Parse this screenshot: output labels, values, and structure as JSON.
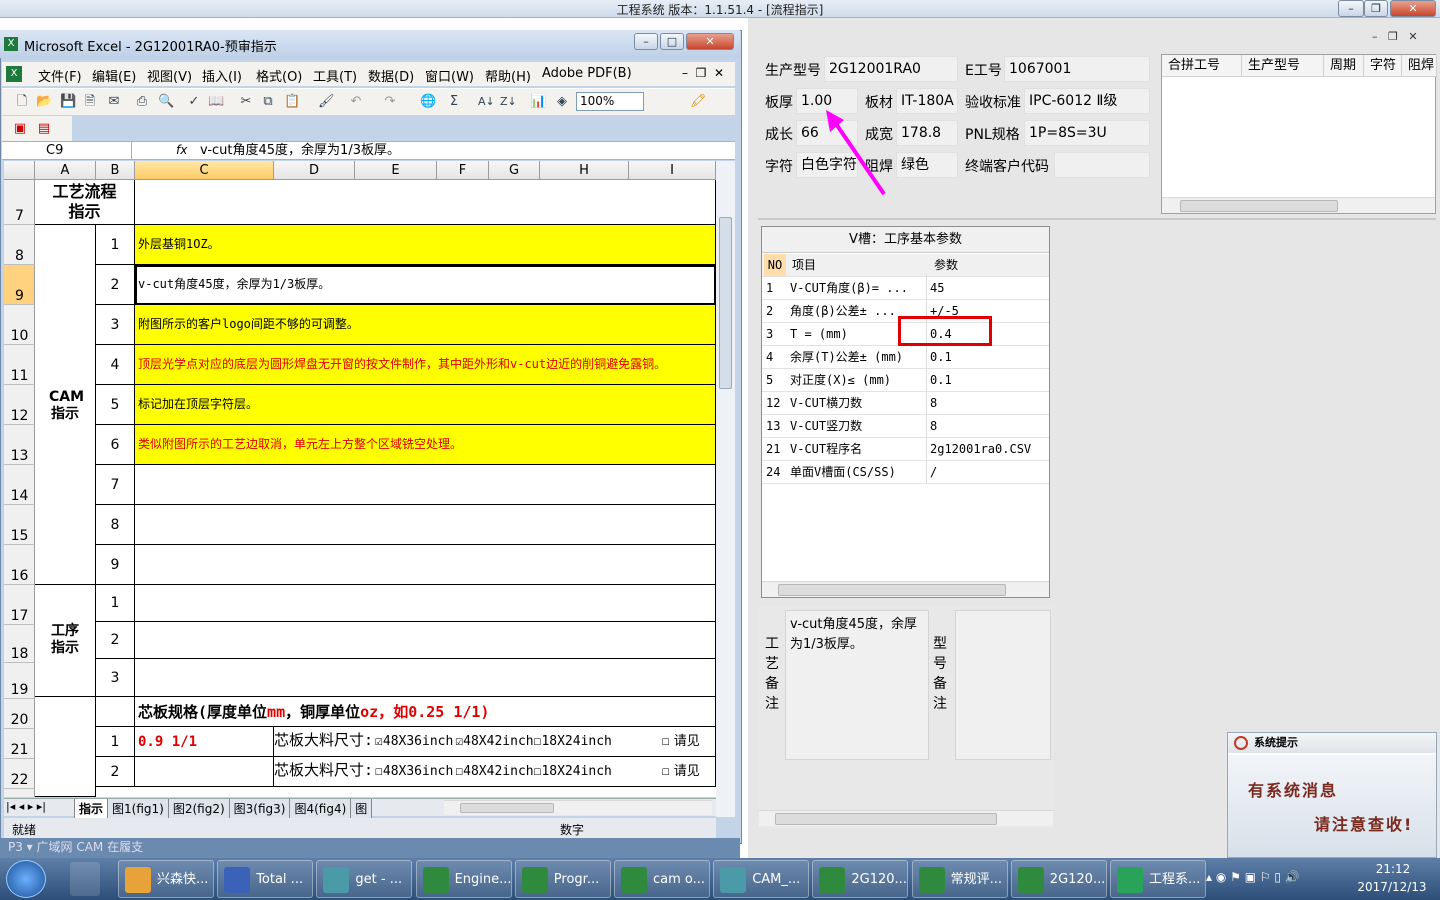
{
  "app_title": "工程系统  版本：1.1.51.4 - [流程指示]",
  "right": {
    "fields": {
      "model_label": "生产型号",
      "model_value": "2G12001RA0",
      "eno_label": "E工号",
      "eno_value": "1067001",
      "thick_label": "板厚",
      "thick_value": "1.00",
      "material_label": "板材",
      "material_value": "IT-180A",
      "std_label": "验收标准",
      "std_value": "IPC-6012 Ⅱ级",
      "len_label": "成长",
      "len_value": "66",
      "wid_label": "成宽",
      "wid_value": "178.8",
      "pnl_label": "PNL规格",
      "pnl_value": "1P=8S=3U",
      "char_label": "字符",
      "char_value": "白色字符",
      "mask_label": "阻焊",
      "mask_value": "绿色",
      "cust_label": "终端客户代码",
      "cust_value": ""
    },
    "grid_headers": [
      "合拼工号",
      "生产型号",
      "周期",
      "字符",
      "阻焊"
    ],
    "vgroove": {
      "title": "V槽：工序基本参数",
      "headers": [
        "NO",
        "项目",
        "参数"
      ],
      "rows": [
        {
          "no": "1",
          "item": "V-CUT角度(β)=  ...",
          "val": "45"
        },
        {
          "no": "2",
          "item": "角度(β)公差±  ...",
          "val": "+/-5"
        },
        {
          "no": "3",
          "item": "T = (mm)",
          "val": "0.4"
        },
        {
          "no": "4",
          "item": "余厚(T)公差±  (mm)",
          "val": "0.1"
        },
        {
          "no": "5",
          "item": "对正度(X)≤ (mm)",
          "val": "0.1"
        },
        {
          "no": "12",
          "item": "V-CUT横刀数",
          "val": "8"
        },
        {
          "no": "13",
          "item": "V-CUT竖刀数",
          "val": "8"
        },
        {
          "no": "21",
          "item": "V-CUT程序名",
          "val": "2g12001ra0.CSV"
        },
        {
          "no": "24",
          "item": "单面V槽面(CS/SS)",
          "val": "/"
        }
      ]
    },
    "process_note_label": "工艺备注",
    "process_note_text": "v-cut角度45度，余厚为1/3板厚。",
    "model_note_label": "型号备注"
  },
  "excel": {
    "title": "Microsoft Excel - 2G12001RA0-预审指示",
    "menus": [
      "文件(F)",
      "编辑(E)",
      "视图(V)",
      "插入(I)",
      "格式(O)",
      "工具(T)",
      "数据(D)",
      "窗口(W)",
      "帮助(H)",
      "Adobe PDF(B)"
    ],
    "zoom": "100%",
    "name_box": "C9",
    "fx": "fx",
    "formula": "v-cut角度45度，余厚为1/3板厚。",
    "columns": [
      "A",
      "B",
      "C",
      "D",
      "E",
      "F",
      "G",
      "H",
      "I"
    ],
    "row_numbers": [
      "7",
      "8",
      "9",
      "10",
      "11",
      "12",
      "13",
      "14",
      "15",
      "16",
      "17",
      "18",
      "19",
      "20",
      "21",
      "22"
    ],
    "a7": "工艺流程指示",
    "cam_label": "CAM指示",
    "proc_label": "工序指示",
    "cam_items": [
      {
        "n": "1",
        "text": "外层基铜1OZ。"
      },
      {
        "n": "2",
        "text": "v-cut角度45度，余厚为1/3板厚。"
      },
      {
        "n": "3",
        "text": "附图所示的客户logo间距不够的可调整。"
      },
      {
        "n": "4",
        "text": "顶层光学点对应的底层为圆形焊盘无开窗的按文件制作，其中距外形和v-cut边近的削铜避免露铜。"
      },
      {
        "n": "5",
        "text": "标记加在顶层字符层。"
      },
      {
        "n": "6",
        "text": "类似附图所示的工艺边取消，单元左上方整个区域铣空处理。"
      },
      {
        "n": "7",
        "text": ""
      },
      {
        "n": "8",
        "text": ""
      },
      {
        "n": "9",
        "text": ""
      }
    ],
    "proc_items": [
      "1",
      "2",
      "3"
    ],
    "core_title_a": "芯板规格(厚度单位",
    "core_title_mm": "mm",
    "core_title_b": "，铜厚单位",
    "core_title_oz": "oz",
    "core_title_c": "，如0.25 1/1)",
    "core_rows": [
      {
        "n": "1",
        "spec": "0.9 1/1",
        "label": "芯板大料尺寸:",
        "o1": "48X36inch",
        "o2": "48X42inch",
        "o3": "18X24inch",
        "o4": "请见"
      },
      {
        "n": "2",
        "spec": "",
        "label": "芯板大料尺寸:",
        "o1": "48X36inch",
        "o2": "48X42inch",
        "o3": "18X24inch",
        "o4": "请见"
      }
    ],
    "sheet_tabs": [
      "指示",
      "图1(fig1)",
      "图2(fig2)",
      "图3(fig3)",
      "图4(fig4)",
      "图"
    ],
    "status_left": "就绪",
    "status_num": "数字"
  },
  "behind_tabs": "P3 ▾ 广域网 CAM 在履支",
  "popup": {
    "title": "系统提示",
    "line1": "有系统消息",
    "line2": "请注意查收!"
  },
  "taskbar": {
    "items": [
      "兴森快...",
      "Total ...",
      "get - ...",
      "Engine...",
      "Progr...",
      "cam o...",
      "CAM_...",
      "2G120...",
      "常规评...",
      "2G120...",
      "工程系..."
    ],
    "time": "21:12",
    "date": "2017/12/13"
  },
  "colors": {
    "yellow": "#ffff00",
    "red": "#e00000",
    "magenta": "#ff00ff"
  }
}
